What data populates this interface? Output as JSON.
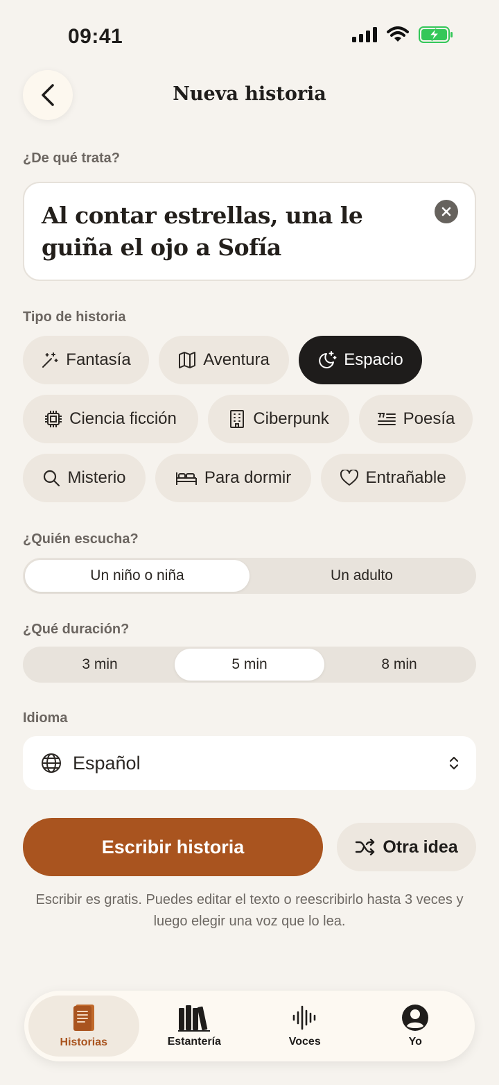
{
  "status_bar": {
    "time": "09:41"
  },
  "header": {
    "title": "Nueva historia"
  },
  "prompt": {
    "label": "¿De qué trata?",
    "text": "Al contar estrellas, una le guiña el ojo a Sofía"
  },
  "story_type": {
    "label": "Tipo de historia",
    "chips": [
      {
        "label": "Fantasía",
        "icon": "magic-wand-icon",
        "selected": false
      },
      {
        "label": "Aventura",
        "icon": "map-icon",
        "selected": false
      },
      {
        "label": "Espacio",
        "icon": "moon-stars-icon",
        "selected": true
      },
      {
        "label": "Ciencia ficción",
        "icon": "chip-icon",
        "selected": false
      },
      {
        "label": "Ciberpunk",
        "icon": "building-icon",
        "selected": false
      },
      {
        "label": "Poesía",
        "icon": "quote-lines-icon",
        "selected": false
      },
      {
        "label": "Misterio",
        "icon": "search-icon",
        "selected": false
      },
      {
        "label": "Para dormir",
        "icon": "bed-icon",
        "selected": false
      },
      {
        "label": "Entrañable",
        "icon": "heart-icon",
        "selected": false
      }
    ]
  },
  "listener": {
    "label": "¿Quién escucha?",
    "options": [
      "Un niño o niña",
      "Un adulto"
    ],
    "selected": "Un niño o niña"
  },
  "duration": {
    "label": "¿Qué duración?",
    "options": [
      "3 min",
      "5 min",
      "8 min"
    ],
    "selected": "5 min"
  },
  "language": {
    "label": "Idioma",
    "value": "Español"
  },
  "actions": {
    "primary_label": "Escribir historia",
    "secondary_label": "Otra idea"
  },
  "helper_text": "Escribir es gratis. Puedes editar el texto o reescribirlo hasta 3 veces y luego elegir una voz que lo lea.",
  "tab_bar": {
    "tabs": [
      {
        "label": "Historias",
        "icon": "book-icon",
        "active": true
      },
      {
        "label": "Estantería",
        "icon": "bookshelf-icon",
        "active": false
      },
      {
        "label": "Voces",
        "icon": "waveform-icon",
        "active": false
      },
      {
        "label": "Yo",
        "icon": "profile-icon",
        "active": false
      }
    ]
  },
  "colors": {
    "background": "#f6f3ee",
    "accent": "#a9541f",
    "chip": "#ede7df",
    "chip_selected": "#1e1c1b",
    "battery": "#34c759"
  }
}
